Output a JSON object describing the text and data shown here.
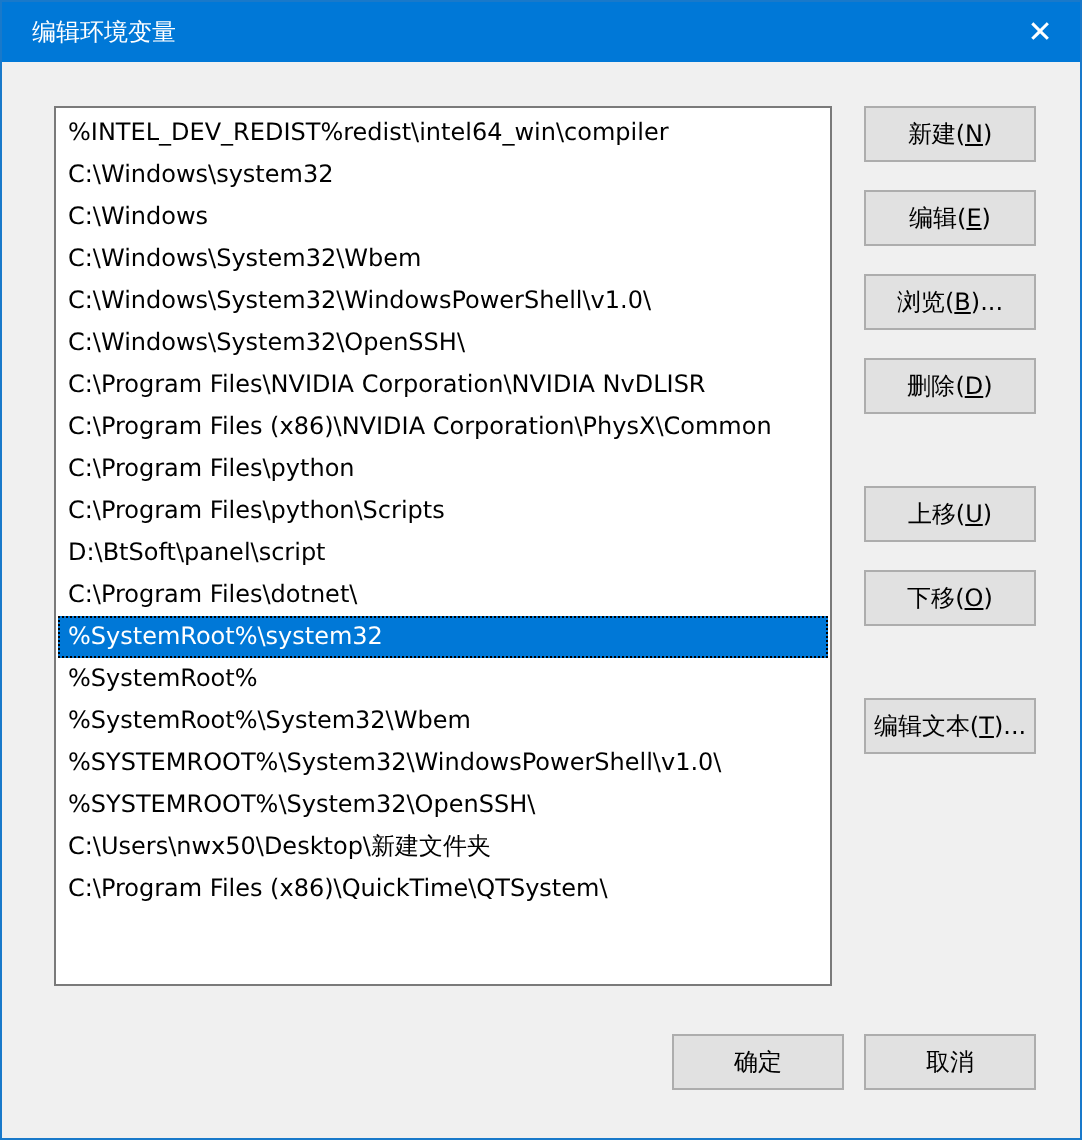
{
  "window": {
    "title": "编辑环境变量",
    "close": "✕"
  },
  "paths": [
    {
      "text": "%INTEL_DEV_REDIST%redist\\intel64_win\\compiler",
      "selected": false
    },
    {
      "text": "C:\\Windows\\system32",
      "selected": false
    },
    {
      "text": "C:\\Windows",
      "selected": false
    },
    {
      "text": "C:\\Windows\\System32\\Wbem",
      "selected": false
    },
    {
      "text": "C:\\Windows\\System32\\WindowsPowerShell\\v1.0\\",
      "selected": false
    },
    {
      "text": "C:\\Windows\\System32\\OpenSSH\\",
      "selected": false
    },
    {
      "text": "C:\\Program Files\\NVIDIA Corporation\\NVIDIA NvDLISR",
      "selected": false
    },
    {
      "text": "C:\\Program Files (x86)\\NVIDIA Corporation\\PhysX\\Common",
      "selected": false
    },
    {
      "text": "C:\\Program Files\\python",
      "selected": false
    },
    {
      "text": "C:\\Program Files\\python\\Scripts",
      "selected": false
    },
    {
      "text": "D:\\BtSoft\\panel\\script",
      "selected": false
    },
    {
      "text": "C:\\Program Files\\dotnet\\",
      "selected": false
    },
    {
      "text": "%SystemRoot%\\system32",
      "selected": true
    },
    {
      "text": "%SystemRoot%",
      "selected": false
    },
    {
      "text": "%SystemRoot%\\System32\\Wbem",
      "selected": false
    },
    {
      "text": "%SYSTEMROOT%\\System32\\WindowsPowerShell\\v1.0\\",
      "selected": false
    },
    {
      "text": "%SYSTEMROOT%\\System32\\OpenSSH\\",
      "selected": false
    },
    {
      "text": "C:\\Users\\nwx50\\Desktop\\新建文件夹",
      "selected": false
    },
    {
      "text": "C:\\Program Files (x86)\\QuickTime\\QTSystem\\",
      "selected": false
    }
  ],
  "side_button_groups": [
    [
      {
        "before": "新建(",
        "key": "N",
        "after": ")"
      },
      {
        "before": "编辑(",
        "key": "E",
        "after": ")"
      },
      {
        "before": "浏览(",
        "key": "B",
        "after": ")..."
      },
      {
        "before": "删除(",
        "key": "D",
        "after": ")"
      }
    ],
    [
      {
        "before": "上移(",
        "key": "U",
        "after": ")"
      },
      {
        "before": "下移(",
        "key": "O",
        "after": ")"
      }
    ],
    [
      {
        "before": "编辑文本(",
        "key": "T",
        "after": ")..."
      }
    ]
  ],
  "footer_buttons": [
    {
      "label": "确定"
    },
    {
      "label": "取消"
    }
  ]
}
